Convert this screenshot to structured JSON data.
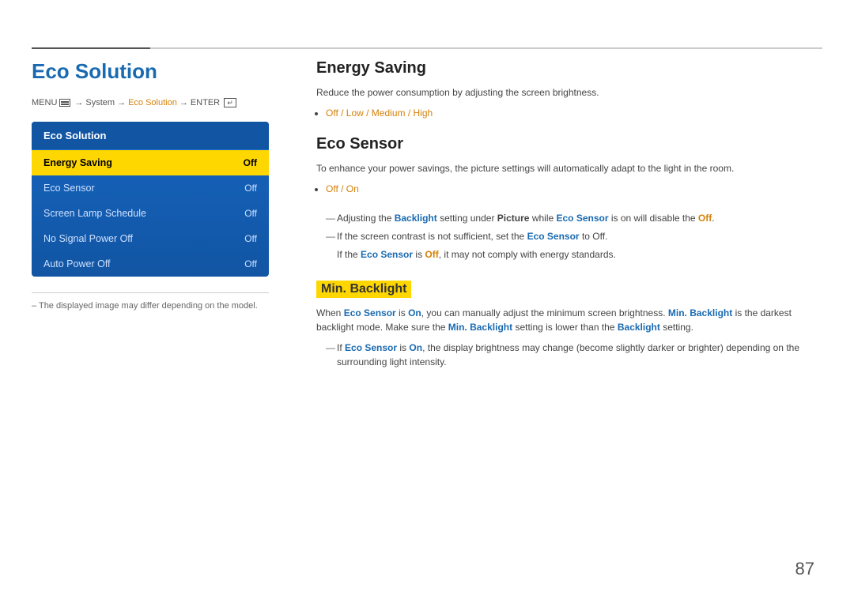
{
  "top": {
    "accent_border_width": "150px"
  },
  "left": {
    "page_title": "Eco Solution",
    "breadcrumb": {
      "menu_label": "MENU",
      "system": "System",
      "eco_solution": "Eco Solution",
      "enter": "ENTER"
    },
    "menu_panel": {
      "title": "Eco Solution",
      "items": [
        {
          "label": "Energy Saving",
          "value": "Off",
          "active": true
        },
        {
          "label": "Eco Sensor",
          "value": "Off",
          "active": false
        },
        {
          "label": "Screen Lamp Schedule",
          "value": "Off",
          "active": false
        },
        {
          "label": "No Signal Power Off",
          "value": "Off",
          "active": false
        },
        {
          "label": "Auto Power Off",
          "value": "Off",
          "active": false
        }
      ]
    },
    "note": "–  The displayed image may differ depending on the model."
  },
  "right": {
    "energy_saving": {
      "title": "Energy Saving",
      "desc": "Reduce the power consumption by adjusting the screen brightness.",
      "options": "Off / Low / Medium / High"
    },
    "eco_sensor": {
      "title": "Eco Sensor",
      "desc": "To enhance your power savings, the picture settings will automatically adapt to the light in the room.",
      "options": "Off / On",
      "note1_prefix": "Adjusting the ",
      "note1_backlight": "Backlight",
      "note1_mid": " setting under ",
      "note1_picture": "Picture",
      "note1_mid2": " while ",
      "note1_eco": "Eco Sensor",
      "note1_mid3": " is on will disable the ",
      "note1_off": "Off",
      "note1_end": ".",
      "note2": "If the screen contrast is not sufficient, set the ",
      "note2_eco": "Eco Sensor",
      "note2_end": " to Off.",
      "note3_prefix": "If the ",
      "note3_eco": "Eco Sensor",
      "note3_is": " is ",
      "note3_off": "Off",
      "note3_end": ", it may not comply with energy standards."
    },
    "min_backlight": {
      "title": "Min. Backlight",
      "desc1_prefix": "When ",
      "desc1_eco": "Eco Sensor",
      "desc1_is": " is ",
      "desc1_on": "On",
      "desc1_mid": ", you can manually adjust the minimum screen brightness. ",
      "desc1_min": "Min. Backlight",
      "desc1_mid2": " is the darkest backlight mode. Make sure the ",
      "desc1_min2": "Min. Backlight",
      "desc1_mid3": " setting is lower than the ",
      "desc1_backlight": "Backlight",
      "desc1_end": " setting.",
      "note_prefix": "If ",
      "note_eco": "Eco Sensor",
      "note_is": " is ",
      "note_on": "On",
      "note_mid": ", the display brightness may change (become slightly darker or brighter) depending on the surrounding light intensity."
    }
  },
  "page_number": "87"
}
